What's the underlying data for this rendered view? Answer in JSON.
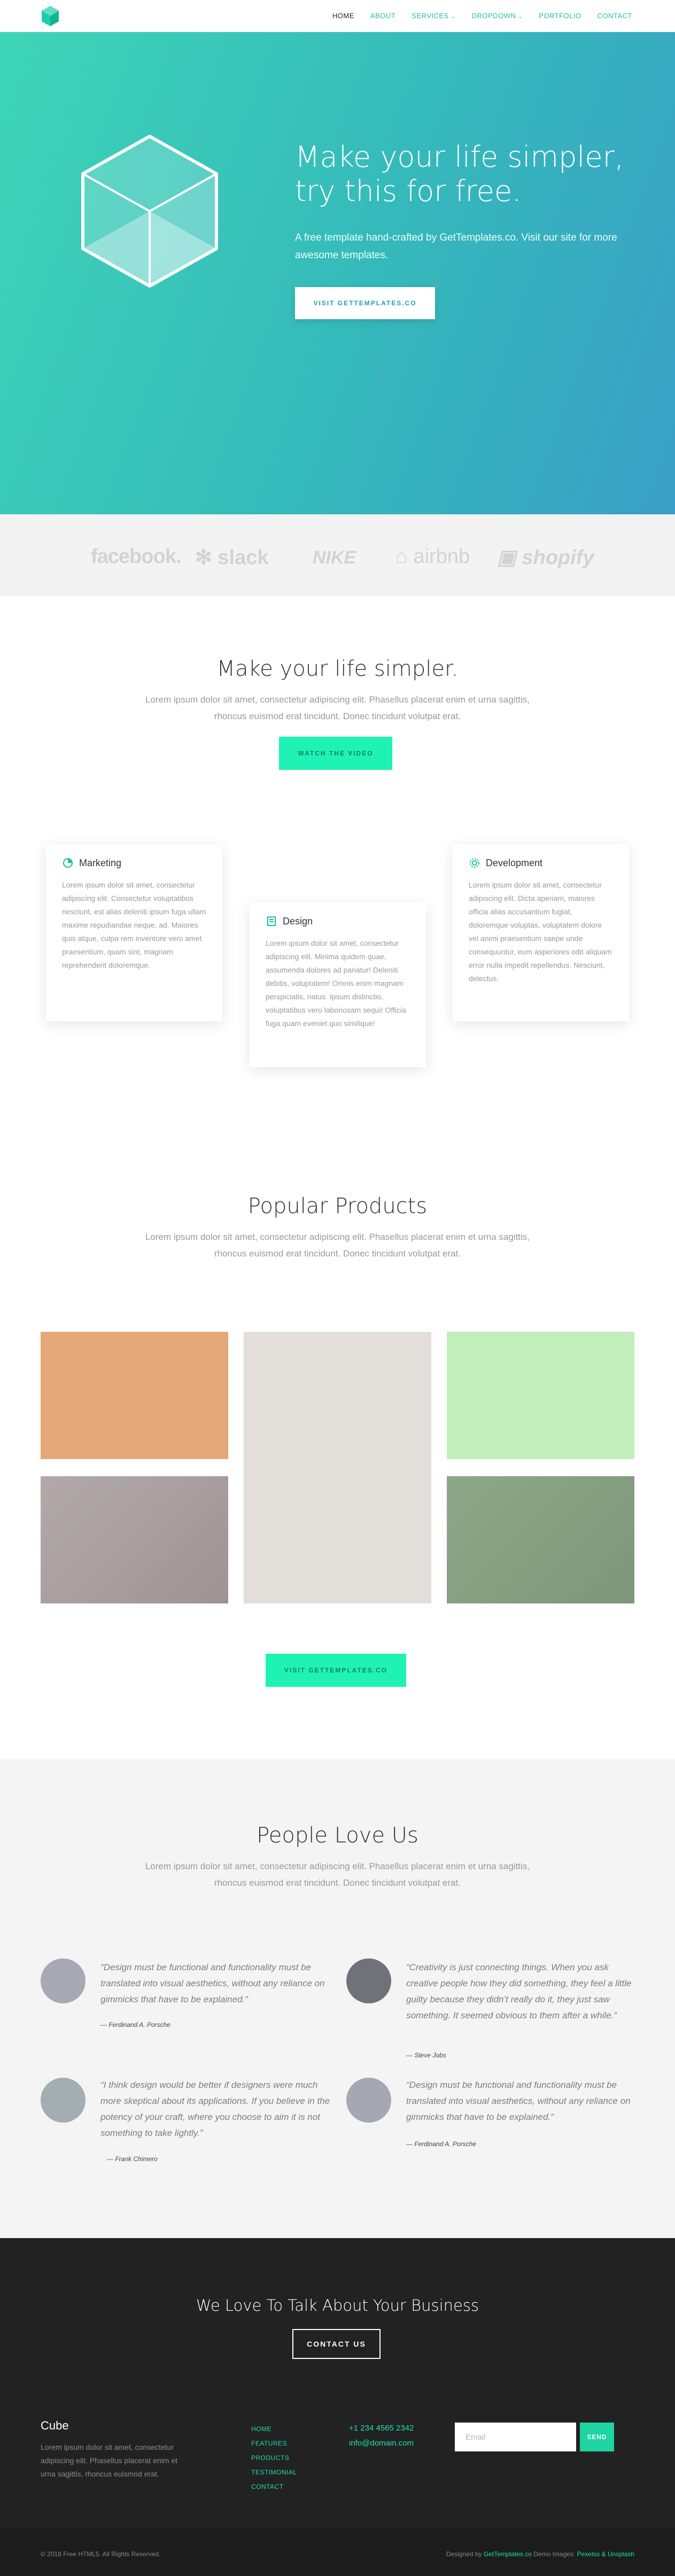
{
  "nav": {
    "brand_color": "#1ccfa9",
    "items": [
      {
        "label": "HOME",
        "active": true
      },
      {
        "label": "ABOUT"
      },
      {
        "label": "SERVICES",
        "dropdown": true
      },
      {
        "label": "DROPDOWN",
        "dropdown": true
      },
      {
        "label": "PORTFOLIO"
      },
      {
        "label": "CONTACT"
      }
    ]
  },
  "hero": {
    "title_line1": "Make your life simpler,",
    "title_line2": "try this for free.",
    "subtitle": "A free template hand-crafted by GetTemplates.co. Visit our site for more awesome templates.",
    "button": "VISIT GETTEMPLATES.CO",
    "gradient": [
      "#3ed5b8",
      "#3a9fc6"
    ]
  },
  "clients": [
    "facebook.",
    "slack",
    "NIKE",
    "airbnb",
    "shopify"
  ],
  "intro": {
    "title": "Make your life simpler.",
    "text": "Lorem ipsum dolor sit amet, consectetur adipiscing elit. Phasellus placerat enim et urna sagittis, rhoncus euismod erat tincidunt. Donec tincidunt volutpat erat.",
    "button": "WATCH THE VIDEO"
  },
  "features": [
    {
      "icon": "pie-chart-icon",
      "title": "Marketing",
      "text": "Lorem ipsum dolor sit amet, consectetur adipiscing elit. Consectetur voluptatibus nesciunt, est alias deleniti ipsum fuga ullam maxime repudiandae neque, ad. Maiores quis atque, culpa rem inventore vero amet praesentium, quam sint, magnam reprehenderit doloremque."
    },
    {
      "icon": "book-icon",
      "title": "Design",
      "text": "Lorem ipsum dolor sit amet, consectetur adipiscing elit. Minima quidem quae, assumenda dolores ad pariatur! Deleniti debitis, voluptatem! Omnis enim magnam perspiciatis, natus. Ipsum distinctio, voluptatibus vero laboriosam sequi! Officia fuga quam eveniet quo similique!"
    },
    {
      "icon": "gear-icon",
      "title": "Development",
      "text": "Lorem ipsum dolor sit amet, consectetur adipiscing elit. Dicta aperiam, maiores officia alias accusantium fugiat, doloremque voluptas, voluptatem dolore vel animi praesentium saepe unde consequuntur, eum asperiores odit aliquam error nulla impedit repellendus. Nesciunt, delectus."
    }
  ],
  "products": {
    "title": "Popular Products",
    "text": "Lorem ipsum dolor sit amet, consectetur adipiscing elit. Phasellus placerat enim et urna sagittis, rhoncus euismod erat tincidunt. Donec tincidunt volutpat erat.",
    "colors": [
      "#e3a878",
      "#e2deda",
      "#c2eebb",
      "#aca3a5",
      "#879e82"
    ],
    "button": "VISIT GETTEMPLATES.CO"
  },
  "testimonials": {
    "title": "People Love Us",
    "text": "Lorem ipsum dolor sit amet, consectetur adipiscing elit. Phasellus placerat enim et urna sagittis, rhoncus euismod erat tincidunt. Donec tincidunt volutpat erat.",
    "items": [
      {
        "quote": "“Design must be functional and functionality must be translated into visual aesthetics, without any reliance on gimmicks that have to be explained.”",
        "author": "— Ferdinand A. Porsche",
        "avatar": "#a7aab4"
      },
      {
        "quote": "“Creativity is just connecting things. When you ask creative people how they did something, they feel a little guilty because they didn’t really do it, they just saw something. It seemed obvious to them after a while.”",
        "author": "— Steve Jobs",
        "avatar": "#6f7279"
      },
      {
        "quote": "“I think design would be better if designers were much more skeptical about its applications. If you believe in the potency of your craft, where you choose to aim it is not something to take lightly.”",
        "author": "— Frank Chimero",
        "avatar": "#a3aeb3"
      },
      {
        "quote": "“Design must be functional and functionality must be translated into visual aesthetics, without any reliance on gimmicks that have to be explained.”",
        "author": "— Ferdinand A. Porsche",
        "avatar": "#a7a6b3"
      }
    ]
  },
  "cta": {
    "title": "We Love To Talk About Your Business",
    "button": "CONTACT US"
  },
  "footer": {
    "brand": "Cube",
    "text": "Lorem ipsum dolor sit amet, consectetur adipiscing elit. Phasellus placerat enim et urna sagittis, rhoncus euismod erat.",
    "links": [
      "HOME",
      "FEATURES",
      "PRODUCTS",
      "TESTIMONIAL",
      "CONTACT"
    ],
    "phone": "+1 234 4565 2342",
    "email": "info@domain.com",
    "email_placeholder": "Email",
    "send": "SEND",
    "copyright": "© 2018 Free HTML5. All Rights Reserved.",
    "designed_prefix": "Designed by ",
    "designed_link": "GetTemplates.co",
    "designed_mid": " Demo Images: ",
    "designed_images": "Pexelso & Unsplash"
  }
}
